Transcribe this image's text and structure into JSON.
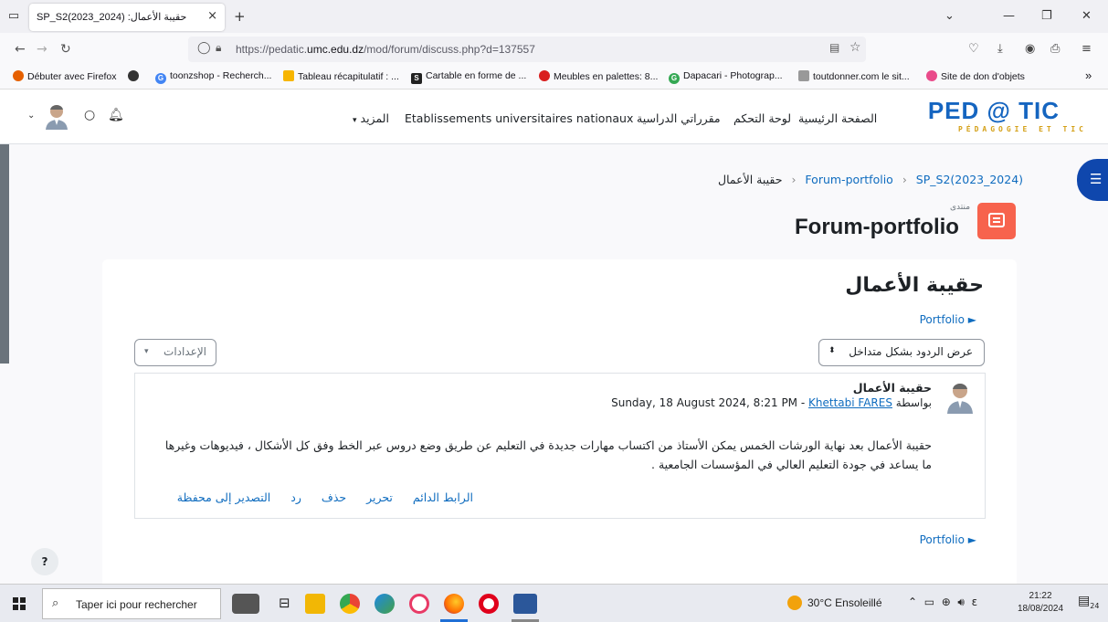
{
  "browser": {
    "tab_title": "SP_S2(2023_2024) :حقيبة الأعمال",
    "tab_close": "×",
    "new_tab": "+",
    "url_prefix": "https://pedatic.",
    "url_domain": "umc.edu.dz",
    "url_path": "/mod/forum/discuss.php?d=137557",
    "bookmarks": [
      "Débuter avec Firefox",
      "toonzshop - Recherch...",
      "Tableau récapitulatif : ...",
      "Cartable en forme de ...",
      "Meubles en palettes: 8...",
      "Dapacari - Photograp...",
      "toutdonner.com le sit...",
      "Site de don d'objets"
    ]
  },
  "site": {
    "logo_main": "PED @ TIC",
    "logo_sub": "PÉDAGOGIE ET TIC",
    "nav": {
      "home": "الصفحة الرئيسية",
      "dashboard": "لوحة التحكم",
      "my_courses": "مقرراتي الدراسية",
      "establishments": "Etablissements universitaires nationaux",
      "more": "المزيد"
    }
  },
  "breadcrumb": {
    "course": "SP_S2(2023_2024)",
    "forum": "Forum-portfolio",
    "discussion": "حقيبة الأعمال"
  },
  "forum": {
    "type_label": "منتدى",
    "title": "Forum-portfolio"
  },
  "discussion": {
    "title": "حقيبة الأعمال",
    "portfolio_link": "Portfolio ►",
    "settings_label": "الإعدادات",
    "display_mode": "عرض الردود بشكل متداخل"
  },
  "post": {
    "subject": "حقيبة الأعمال",
    "by_label": "بواسطة",
    "author": "Khettabi FARES",
    "date": "Sunday, 18 August 2024, 8:21 PM",
    "body": "حقيبة الأعمال بعد نهاية الورشات الخمس يمكن الأستاذ من اكتساب مهارات جديدة في التعليم عن طريق وضع دروس عبر الخط وفق كل الأشكال ، فيديوهات وغيرها ما يساعد في جودة التعليم العالي في المؤسسات الجامعية .",
    "actions": {
      "permalink": "الرابط الدائم",
      "edit": "تحرير",
      "delete": "حذف",
      "reply": "رد",
      "export": "التصدير إلى محفظة"
    }
  },
  "help_label": "?",
  "taskbar": {
    "search_placeholder": "Taper ici pour rechercher",
    "weather": "30°C Ensoleillé",
    "time": "21:22",
    "date": "18/08/2024",
    "notifications": "24"
  },
  "colors": {
    "link": "#0f6cbf",
    "logo_blue": "#1565c0",
    "logo_gold": "#d4a017",
    "forum_icon_bg": "#f7634d",
    "drawer_bg": "#0f47ad"
  }
}
